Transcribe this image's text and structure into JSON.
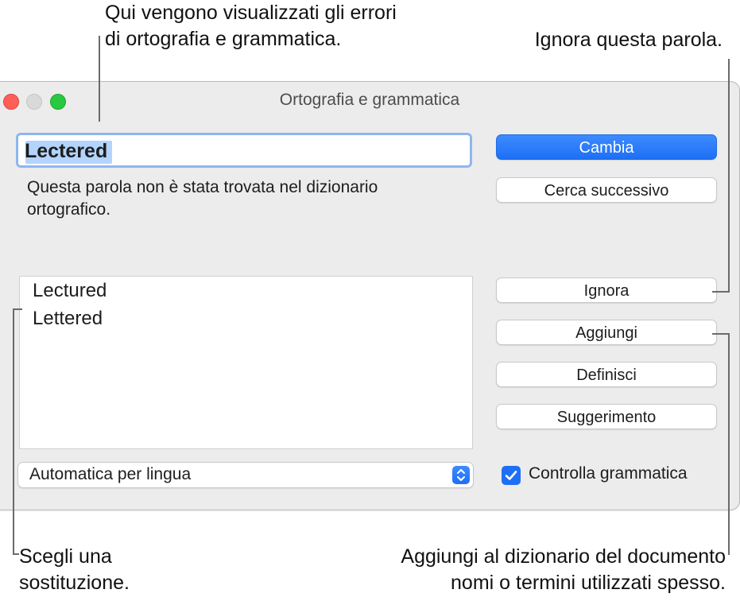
{
  "callouts": {
    "errors_line1": "Qui vengono visualizzati gli errori",
    "errors_line2": "di ortografia e grammatica.",
    "ignore": "Ignora questa parola.",
    "choose_line1": "Scegli una",
    "choose_line2": "sostituzione.",
    "add_line1": "Aggiungi al dizionario del documento",
    "add_line2": "nomi o termini utilizzati spesso."
  },
  "window": {
    "title": "Ortografia e grammatica"
  },
  "misspelled": {
    "word": "Lectered",
    "message_line1": "Questa parola non è stata trovata nel dizionario",
    "message_line2": "ortografico."
  },
  "suggestions": [
    "Lectured",
    "Lettered"
  ],
  "buttons": {
    "change": "Cambia",
    "find_next": "Cerca successivo",
    "ignore": "Ignora",
    "learn": "Aggiungi",
    "define": "Definisci",
    "guess": "Suggerimento"
  },
  "language": {
    "selected": "Automatica per lingua"
  },
  "grammar": {
    "label": "Controlla grammatica",
    "checked": true
  },
  "colors": {
    "accent": "#1f6ff5",
    "close": "#ff5f57",
    "zoom": "#28c840"
  }
}
